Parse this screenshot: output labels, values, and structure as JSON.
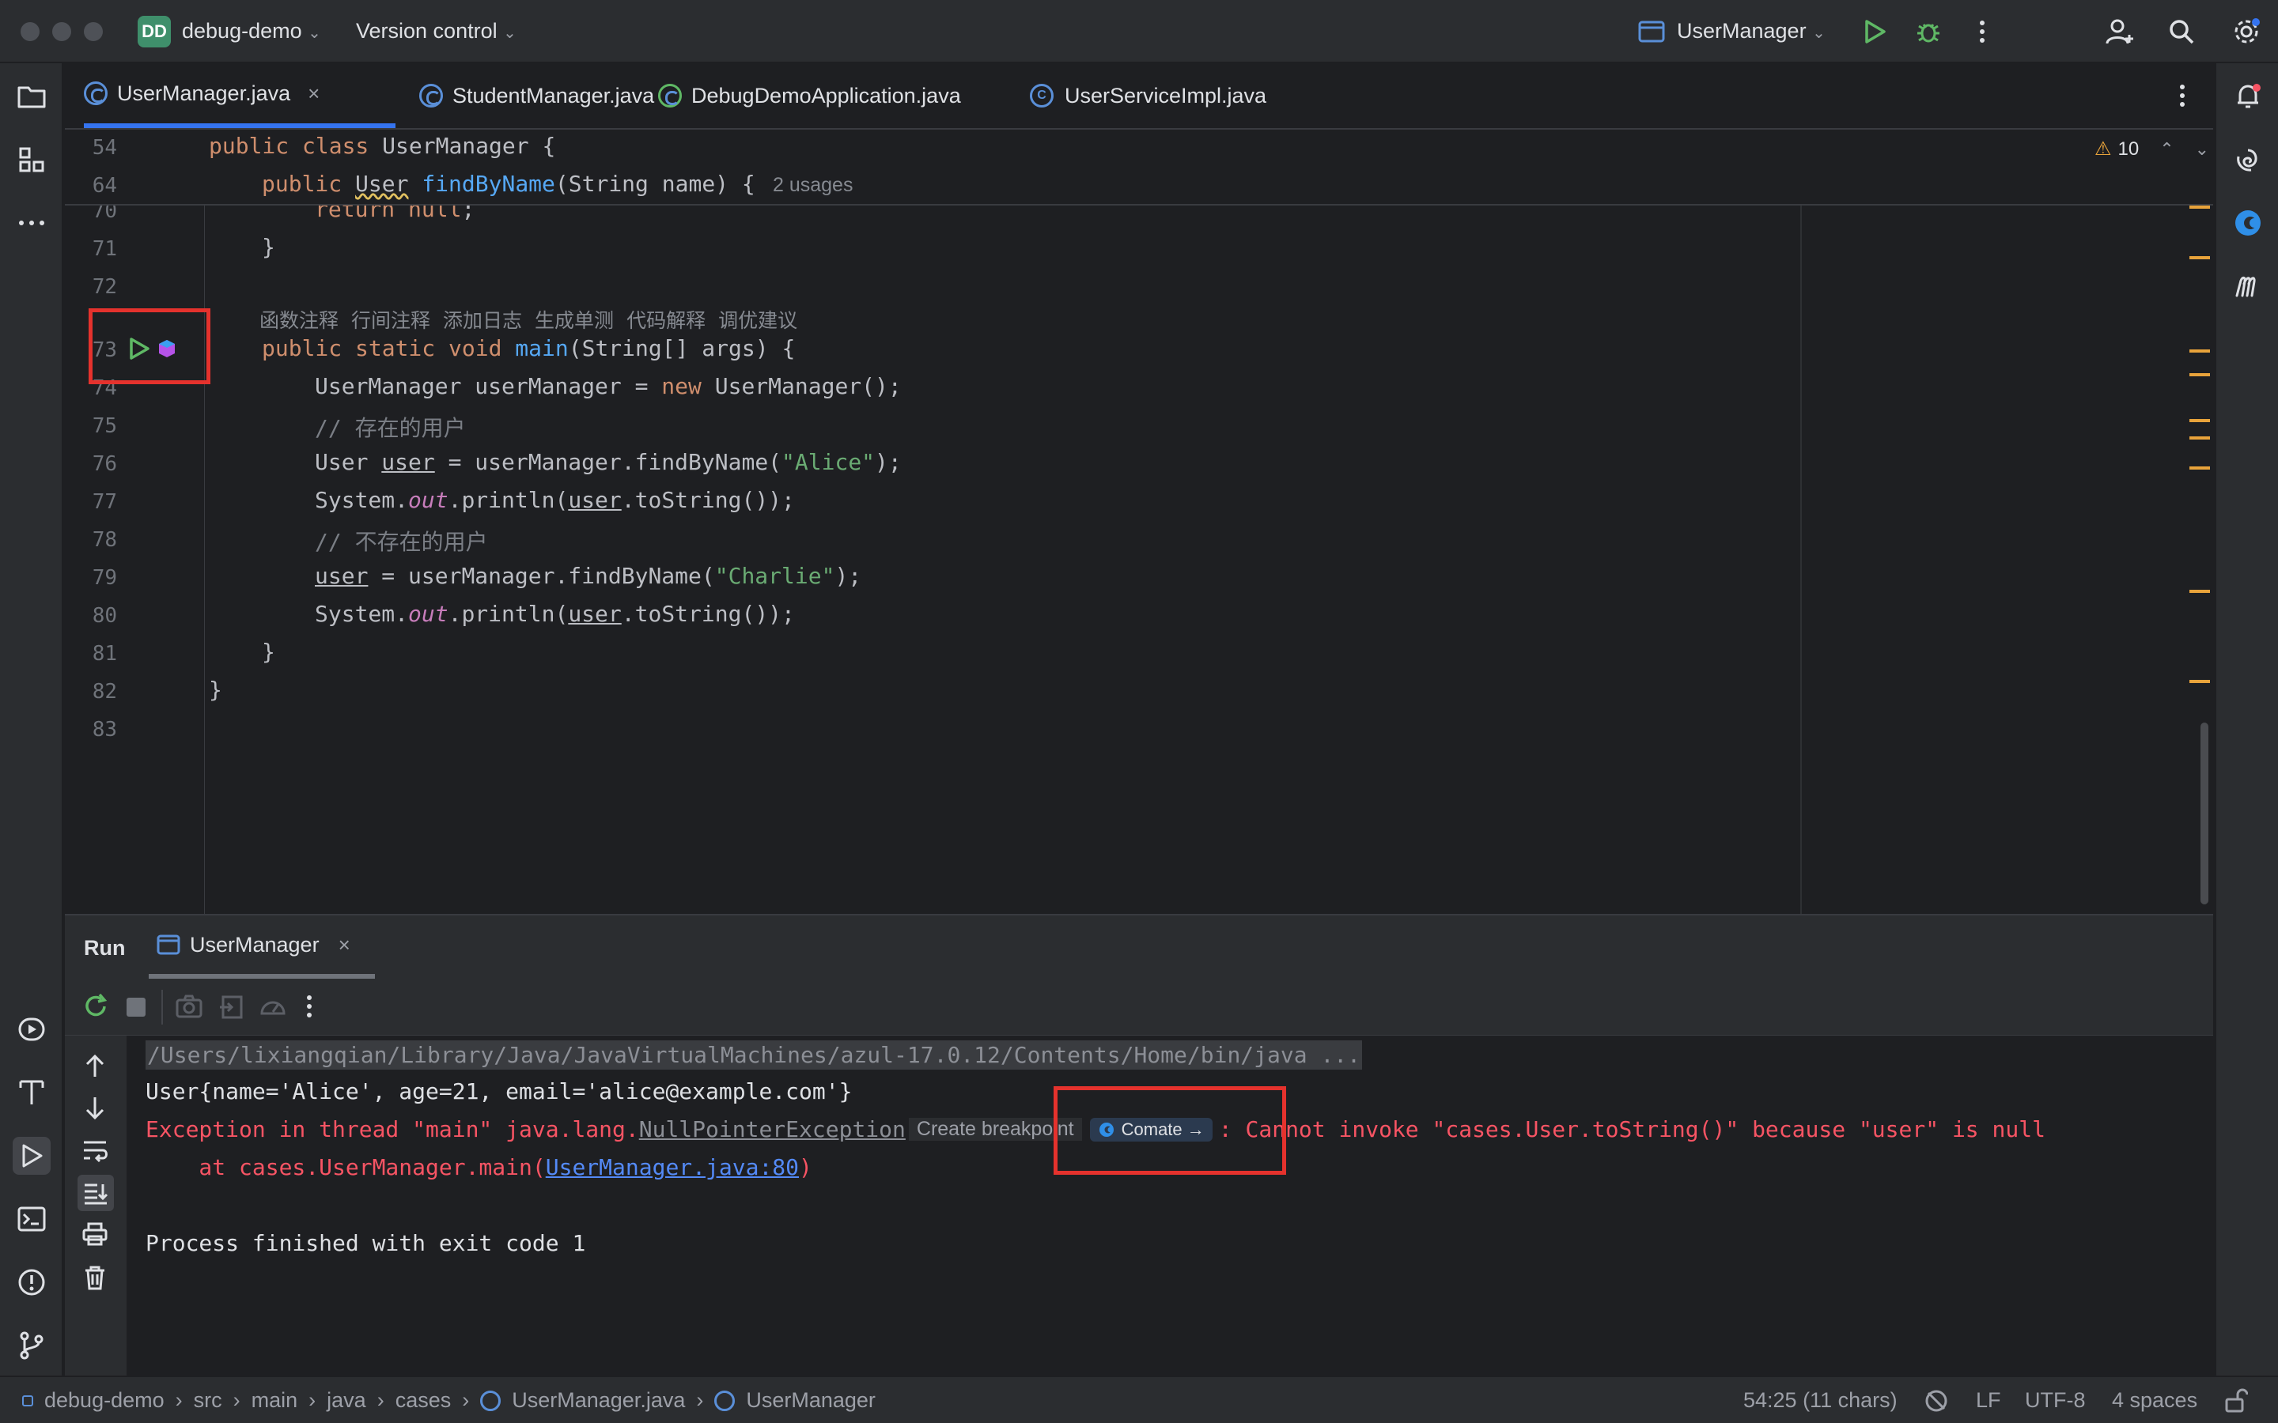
{
  "window": {
    "project_badge": "DD",
    "project_name": "debug-demo",
    "vcs_label": "Version control",
    "run_config": "UserManager"
  },
  "tabs": [
    {
      "label": "UserManager.java"
    },
    {
      "label": "StudentManager.java"
    },
    {
      "label": "DebugDemoApplication.java"
    },
    {
      "label": "UserServiceImpl.java"
    }
  ],
  "editor": {
    "warning_count": "10",
    "sticky": [
      {
        "ln": "54",
        "text": "public class UserManager {"
      },
      {
        "ln": "64",
        "text": "public User findByName(String name) {",
        "hint": "2 usages"
      }
    ],
    "lines": [
      {
        "ln": "70",
        "text": "return null;"
      },
      {
        "ln": "71",
        "text": "}"
      },
      {
        "ln": "72",
        "text": ""
      },
      {
        "ln": "73",
        "text": "public static void main(String[] args) {"
      },
      {
        "ln": "74",
        "text": "UserManager userManager = new UserManager();"
      },
      {
        "ln": "75",
        "text": "// 存在的用户"
      },
      {
        "ln": "76",
        "text": "User user = userManager.findByName(\"Alice\");"
      },
      {
        "ln": "77",
        "text": "System.out.println(user.toString());"
      },
      {
        "ln": "78",
        "text": "// 不存在的用户"
      },
      {
        "ln": "79",
        "text": "user = userManager.findByName(\"Charlie\");"
      },
      {
        "ln": "80",
        "text": "System.out.println(user.toString());"
      },
      {
        "ln": "81",
        "text": "}"
      },
      {
        "ln": "82",
        "text": "}"
      },
      {
        "ln": "83",
        "text": ""
      }
    ],
    "codelens": [
      "函数注释",
      "行间注释",
      "添加日志",
      "生成单测",
      "代码解释",
      "调优建议"
    ]
  },
  "run": {
    "title": "Run",
    "tab_label": "UserManager",
    "console": {
      "cmd": "/Users/lixiangqian/Library/Java/JavaVirtualMachines/azul-17.0.12/Contents/Home/bin/java ...",
      "out1": "User{name='Alice', age=21, email='alice@example.com'}",
      "exc_prefix": "Exception in thread \"main\" java.lang.",
      "exc_class": "NullPointerException",
      "create_breakpoint": "Create breakpoint",
      "comate_button": "Comate →",
      "exc_suffix": ": Cannot invoke \"cases.User.toString()\" because \"user\" is null",
      "at_prefix": "    at cases.UserManager.main(",
      "at_link": "UserManager.java:80",
      "at_suffix": ")",
      "finished": "Process finished with exit code 1"
    }
  },
  "statusbar": {
    "breadcrumbs": [
      "debug-demo",
      "src",
      "main",
      "java",
      "cases",
      "UserManager.java",
      "UserManager"
    ],
    "position": "54:25 (11 chars)",
    "line_sep": "LF",
    "encoding": "UTF-8",
    "indent": "4 spaces"
  },
  "colors": {
    "accent": "#3574f0",
    "error": "#f75464",
    "highlight_box": "#e5322d",
    "run_green": "#5fb865"
  }
}
